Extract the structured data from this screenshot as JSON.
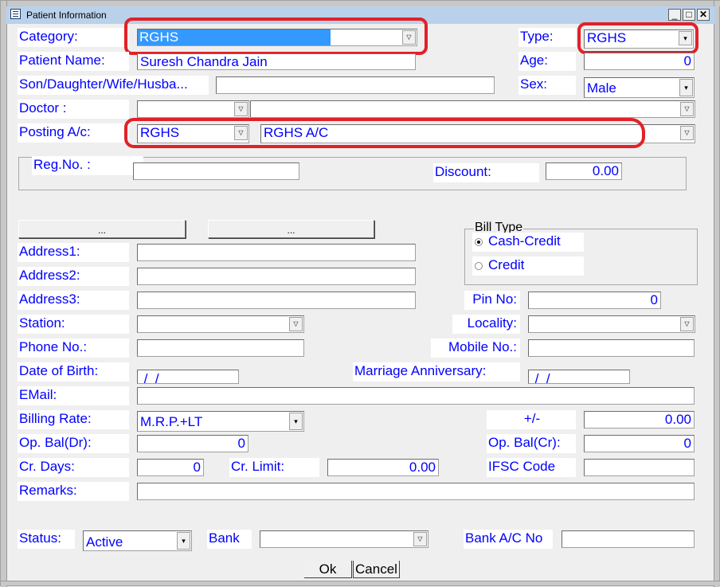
{
  "window": {
    "title": "Patient Information",
    "controls": {
      "minimize": "_",
      "maximize": "□",
      "close": "✕"
    }
  },
  "form": {
    "category": {
      "label": "Category:",
      "value": "RGHS"
    },
    "type": {
      "label": "Type:",
      "value": "RGHS"
    },
    "patient_name": {
      "label": "Patient Name:",
      "value": "Suresh Chandra Jain"
    },
    "age": {
      "label": "Age:",
      "value": "0"
    },
    "relation": {
      "label": "Son/Daughter/Wife/Husba...",
      "value": ""
    },
    "sex": {
      "label": "Sex:",
      "value": "Male"
    },
    "doctor": {
      "label": "Doctor :",
      "code": "",
      "name": ""
    },
    "posting_ac": {
      "label": "Posting A/c:",
      "code": "RGHS",
      "name": "RGHS A/C"
    },
    "reg_no": {
      "label": "Reg.No. :",
      "value": ""
    },
    "discount": {
      "label": "Discount:",
      "value": "0.00"
    },
    "browse_button_1": "...",
    "browse_button_2": "...",
    "bill_type": {
      "label": "Bill Type",
      "options": [
        {
          "label": "Cash-Credit",
          "selected": true
        },
        {
          "label": "Credit",
          "selected": false
        }
      ]
    },
    "address1": {
      "label": "Address1:",
      "value": ""
    },
    "address2": {
      "label": "Address2:",
      "value": ""
    },
    "address3": {
      "label": "Address3:",
      "value": ""
    },
    "pin_no": {
      "label": "Pin No:",
      "value": "0"
    },
    "station": {
      "label": "Station:",
      "value": ""
    },
    "locality": {
      "label": "Locality:",
      "value": ""
    },
    "phone_no": {
      "label": "Phone No.:",
      "value": ""
    },
    "mobile_no": {
      "label": "Mobile No.:",
      "value": ""
    },
    "date_of_birth": {
      "label": "Date of Birth:",
      "value": " /  /"
    },
    "marriage_anniversary": {
      "label": "Marriage Anniversary:",
      "value": " /  /"
    },
    "email": {
      "label": "EMail:",
      "value": ""
    },
    "billing_rate": {
      "label": "Billing Rate:",
      "value": "M.R.P.+LT"
    },
    "plus_minus": {
      "label": "+/-",
      "value": "0.00"
    },
    "op_bal_dr": {
      "label": "Op. Bal(Dr):",
      "value": "0"
    },
    "op_bal_cr": {
      "label": "Op. Bal(Cr):",
      "value": "0"
    },
    "cr_days": {
      "label": "Cr. Days:",
      "value": "0"
    },
    "cr_limit": {
      "label": "Cr. Limit:",
      "value": "0.00"
    },
    "ifsc_code": {
      "label": "IFSC Code",
      "value": ""
    },
    "remarks": {
      "label": "Remarks:",
      "value": ""
    },
    "status": {
      "label": "Status:",
      "value": "Active"
    },
    "bank": {
      "label": "Bank",
      "value": ""
    },
    "bank_ac_no": {
      "label": "Bank A/C No",
      "value": ""
    }
  },
  "actions": {
    "ok": "Ok",
    "cancel": "Cancel"
  },
  "icons": {
    "dropdown_hollow": "▽",
    "dropdown_solid": "▾"
  },
  "colors": {
    "label_text": "#0000ff",
    "highlight": "#3399ff",
    "annotation": "#e32028"
  }
}
